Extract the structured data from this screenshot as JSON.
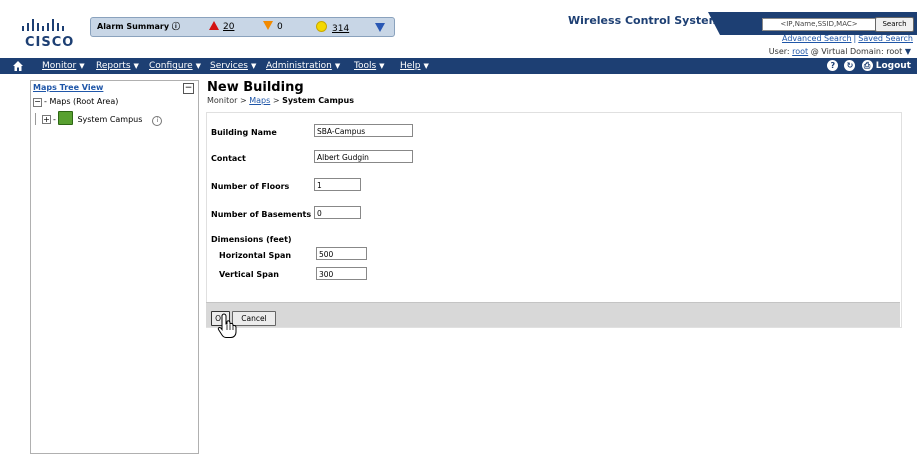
{
  "header": {
    "logo_text": "CISCO",
    "alarm": {
      "label": "Alarm Summary",
      "critical_count": "20",
      "major_count": "0",
      "minor_count": "314"
    },
    "product_title": "Wireless Control System",
    "search": {
      "placeholder": "<IP,Name,SSID,MAC>",
      "button_label": "Search",
      "advanced_link": "Advanced Search",
      "separator": "|",
      "saved_link": "Saved Search"
    },
    "user": {
      "prefix": "User:",
      "name": "root",
      "domain_label": "@ Virtual Domain:",
      "domain": "root"
    }
  },
  "nav": {
    "items": [
      {
        "label": "Monitor"
      },
      {
        "label": "Reports"
      },
      {
        "label": "Configure"
      },
      {
        "label": "Services"
      },
      {
        "label": "Administration"
      },
      {
        "label": "Tools"
      },
      {
        "label": "Help"
      }
    ],
    "logout_label": "Logout"
  },
  "sidebar": {
    "title": "Maps Tree View",
    "tree": [
      {
        "label": "Maps (Root Area)"
      },
      {
        "label": "System Campus"
      }
    ]
  },
  "main": {
    "title": "New Building",
    "breadcrumb": {
      "root": "Monitor",
      "sep1": ">",
      "maps": "Maps",
      "sep2": ">",
      "current": "System Campus"
    },
    "form": {
      "building_name_label": "Building Name",
      "building_name_value": "SBA-Campus",
      "contact_label": "Contact",
      "contact_value": "Albert Gudgin",
      "floors_label": "Number of Floors",
      "floors_value": "1",
      "basements_label": "Number of Basements",
      "basements_value": "0",
      "dimensions_label": "Dimensions (feet)",
      "horizontal_label": "Horizontal Span",
      "horizontal_value": "500",
      "vertical_label": "Vertical Span",
      "vertical_value": "300"
    },
    "buttons": {
      "ok": "OK",
      "cancel": "Cancel"
    }
  },
  "colors": {
    "nav_bg": "#1d3f73",
    "link": "#1f56a8",
    "alarm_bar": "#c8d6e6",
    "critical": "#d31212",
    "major": "#f28a00",
    "minor": "#f4d800"
  }
}
